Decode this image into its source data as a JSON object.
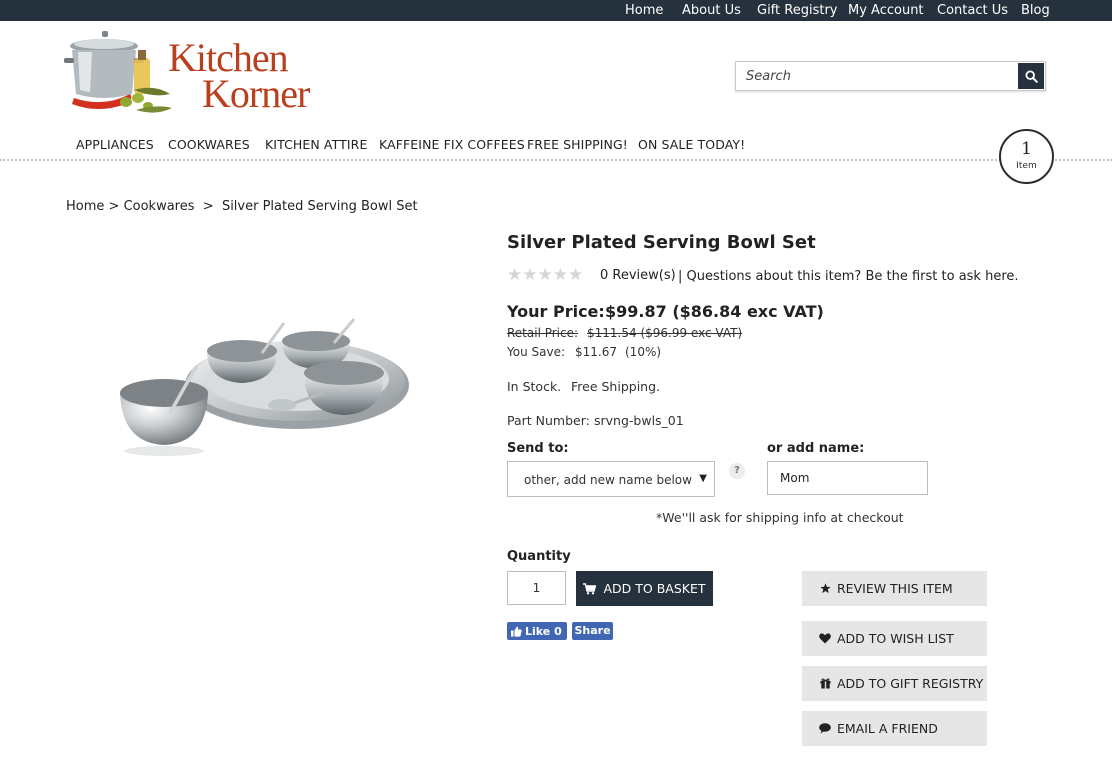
{
  "topnav": [
    "Home",
    "About Us",
    "Gift Registry",
    "My Account",
    "Contact Us",
    "Blog"
  ],
  "logo": {
    "line1": "Kitchen",
    "line2": "Korner"
  },
  "search": {
    "placeholder": "Search",
    "icon": "search-icon"
  },
  "mainnav": [
    "APPLIANCES",
    "COOKWARES",
    "KITCHEN ATTIRE",
    "KAFFEINE FIX COFFEES",
    "FREE SHIPPING!",
    "ON SALE TODAY!"
  ],
  "cart": {
    "count": "1",
    "label": "Item"
  },
  "breadcrumb": {
    "home": "Home",
    "sep1": " > ",
    "category": "Cookwares",
    "sep2": "  >  ",
    "current": "Silver Plated Serving Bowl Set"
  },
  "product": {
    "title": "Silver Plated Serving Bowl Set",
    "stars": "★★★★★",
    "rating": 0,
    "reviews": "0 Review(s)",
    "questions": "| Questions about this item? Be the first to ask here.",
    "price_label": "Your Price:",
    "price": "$99.87 ($86.84 exc VAT)",
    "retail_label": "Retail Price:",
    "retail_price": "$111.54 ($96.99 exc VAT)",
    "save_label": "You Save:",
    "save_amount": "$11.67",
    "save_percent": "(10%)",
    "stock": "In Stock.",
    "shipping": "Free Shipping.",
    "part_label": "Part Number:",
    "part_number": "srvng-bwls_01"
  },
  "sendto": {
    "label": "Send to:",
    "selected": "other, add new name below",
    "help": "?"
  },
  "addname": {
    "label": "or add name:",
    "value": "Mom"
  },
  "ship_note": "*We''ll ask for shipping info at checkout",
  "quantity": {
    "label": "Quantity",
    "value": "1"
  },
  "basket": {
    "label": "ADD TO BASKET"
  },
  "facebook": {
    "like": "Like 0",
    "share": "Share"
  },
  "actions": {
    "review": "REVIEW THIS ITEM",
    "wishlist": "ADD TO WISH LIST",
    "registry": "ADD TO GIFT REGISTRY",
    "email": "EMAIL A FRIEND"
  },
  "colors": {
    "dark": "#25313c",
    "logo": "#b8401f",
    "facebook": "#4267b2",
    "button_gray": "#e6e6e6"
  }
}
